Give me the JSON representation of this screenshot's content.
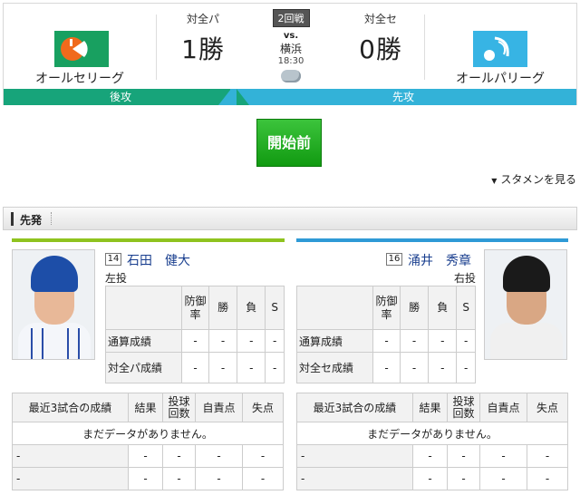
{
  "header": {
    "round_badge": "2回戦",
    "vs": "vs.",
    "stadium": "横浜",
    "time": "18:30",
    "weather_icon": "cloudy-icon",
    "left": {
      "team_name": "オールセリーグ",
      "score_label": "対全パ",
      "score": "1勝",
      "side": "後攻",
      "color": "#17a47a"
    },
    "right": {
      "team_name": "オールパリーグ",
      "score_label": "対全セ",
      "score": "0勝",
      "side": "先攻",
      "color": "#33b2d8"
    }
  },
  "status_button": "開始前",
  "starter_link": "スタメンを見る",
  "section_title": "先発",
  "left_pitcher": {
    "number": "14",
    "name": "石田　健大",
    "hand": "左投",
    "stat_headers": [
      "防御率",
      "勝",
      "負",
      "S"
    ],
    "rows": [
      {
        "label": "通算成績",
        "values": [
          "-",
          "-",
          "-",
          "-"
        ]
      },
      {
        "label": "対全パ成績",
        "values": [
          "-",
          "-",
          "-",
          "-"
        ]
      }
    ],
    "recent": {
      "headers": [
        "最近3試合の成績",
        "結果",
        "投球回数",
        "自責点",
        "失点"
      ],
      "no_data": "まだデータがありません。",
      "rows": [
        [
          "-",
          "-",
          "-",
          "-",
          "-"
        ],
        [
          "-",
          "-",
          "-",
          "-",
          "-"
        ]
      ]
    }
  },
  "right_pitcher": {
    "number": "16",
    "name": "涌井　秀章",
    "hand": "右投",
    "stat_headers": [
      "防御率",
      "勝",
      "負",
      "S"
    ],
    "rows": [
      {
        "label": "通算成績",
        "values": [
          "-",
          "-",
          "-",
          "-"
        ]
      },
      {
        "label": "対全セ成績",
        "values": [
          "-",
          "-",
          "-",
          "-"
        ]
      }
    ],
    "recent": {
      "headers": [
        "最近3試合の成績",
        "結果",
        "投球回数",
        "自責点",
        "失点"
      ],
      "no_data": "まだデータがありません。",
      "rows": [
        [
          "-",
          "-",
          "-",
          "-",
          "-"
        ],
        [
          "-",
          "-",
          "-",
          "-",
          "-"
        ]
      ]
    }
  }
}
